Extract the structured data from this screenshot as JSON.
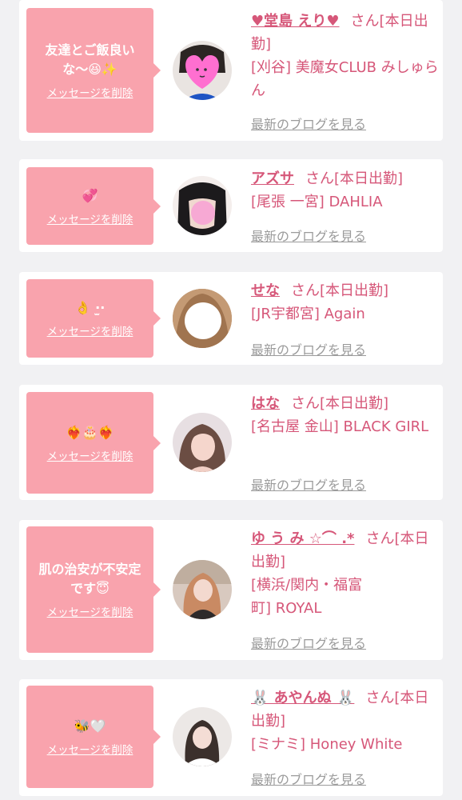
{
  "colors": {
    "accent": "#d65779",
    "bubble": "#f9a3ad",
    "background": "#f1f1f3",
    "muted": "#9b9b9b"
  },
  "delete_label": "メッセージを削除",
  "blog_label": "最新のブログを見る",
  "cards": [
    {
      "message": "友達とご飯良いな〜😆✨",
      "name": "♥堂島 えり♥",
      "status": "さん[本日出勤]",
      "shop": "[刈谷] 美魔女CLUB みしゅらん",
      "avatar_icon": "heart-sticker-face"
    },
    {
      "message": "💞",
      "name": "アズサ",
      "status": "さん[本日出勤]",
      "shop": "[尾張 一宮] DAHLIA",
      "avatar_icon": "pink-circle-face"
    },
    {
      "message": "👌 ·̫·",
      "name": "せな",
      "status": "さん[本日出勤]",
      "shop": "[JR宇都宮] Again",
      "avatar_icon": "white-circle-face"
    },
    {
      "message": "❤️‍🔥🎂❤️‍🔥",
      "name": "はな",
      "status": "さん[本日出勤]",
      "shop": "[名古屋 金山] BLACK GIRL",
      "avatar_icon": "photo-portrait"
    },
    {
      "message": "肌の治安が不安定です😇",
      "name": "ゆ う み ☆⌒ .*",
      "status": "さん[本日出勤]",
      "shop": "[横浜/関内・福富町] ROYAL",
      "avatar_icon": "photo-portrait"
    },
    {
      "message": "🐝🤍",
      "name": "🐰 あやんぬ 🐰",
      "status": "さん[本日出勤]",
      "shop": "[ミナミ] Honey White",
      "avatar_icon": "photo-portrait"
    }
  ]
}
